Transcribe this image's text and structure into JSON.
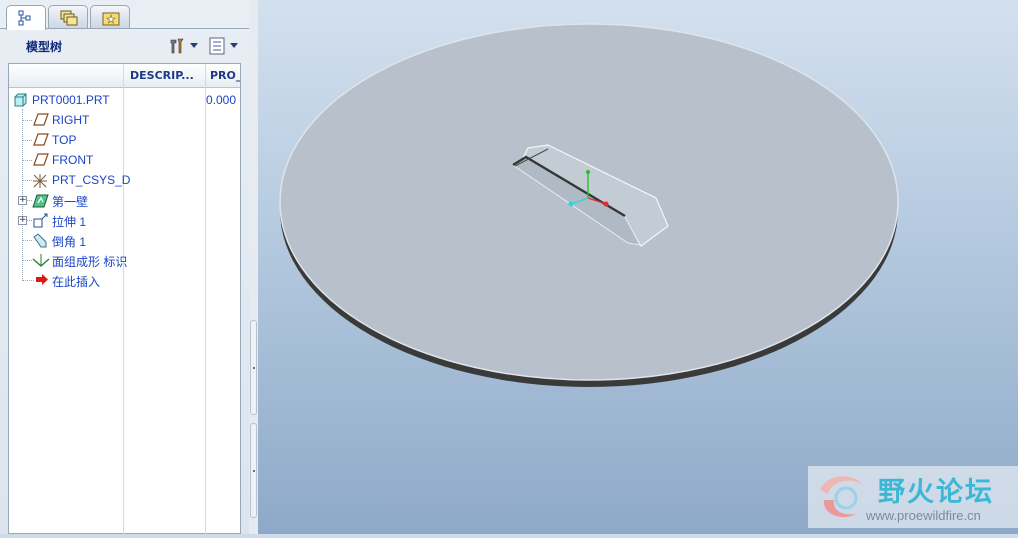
{
  "panel": {
    "tabs": [
      {
        "icon": "model-tree-icon",
        "active": true
      },
      {
        "icon": "layers-icon",
        "active": false
      },
      {
        "icon": "folder-favorites-icon",
        "active": false
      }
    ],
    "title": "模型树",
    "tools": [
      {
        "icon": "settings-tools-icon"
      },
      {
        "icon": "tree-filter-icon"
      }
    ],
    "columns": [
      "DESCRIP...",
      "PRO_"
    ],
    "tree": [
      {
        "label": "PRT0001.PRT",
        "icon": "part-icon",
        "value": "0.000"
      },
      {
        "label": "RIGHT",
        "icon": "datum-plane-icon"
      },
      {
        "label": "TOP",
        "icon": "datum-plane-icon"
      },
      {
        "label": "FRONT",
        "icon": "datum-plane-icon"
      },
      {
        "label": "PRT_CSYS_D",
        "icon": "csys-icon"
      },
      {
        "label": "第一壁",
        "icon": "first-wall-icon",
        "expandable": true
      },
      {
        "label": "拉伸 1",
        "icon": "extrude-icon",
        "expandable": true
      },
      {
        "label": "倒角 1",
        "icon": "chamfer-icon"
      },
      {
        "label": "面组成形 标识",
        "icon": "quilt-form-icon"
      },
      {
        "label": "在此插入",
        "icon": "insert-here-arrow-icon"
      }
    ]
  },
  "viewport": {
    "model": "disc-with-slot"
  },
  "watermark": {
    "title": "野火论坛",
    "url": "www.proewildfire.cn"
  }
}
